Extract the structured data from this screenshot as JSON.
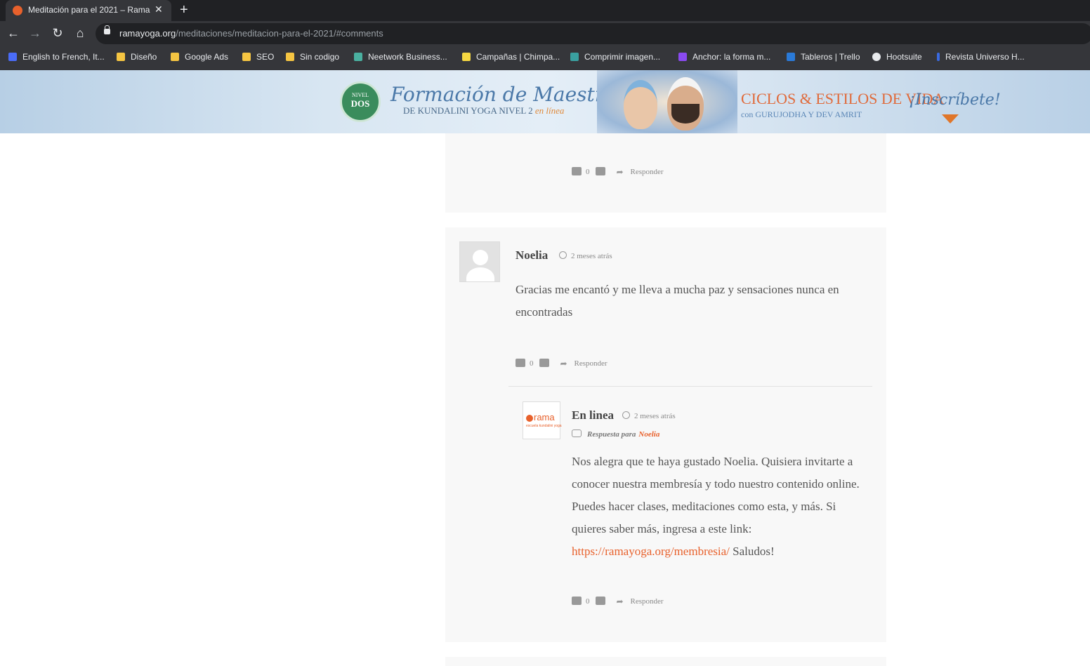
{
  "browser": {
    "tab_title": "Meditación para el 2021 – Rama",
    "url_host": "ramayoga.org",
    "url_path": "/meditaciones/meditacion-para-el-2021/#comments",
    "bookmarks": [
      {
        "label": "English to French, It...",
        "color": "#4a6cf7"
      },
      {
        "label": "Diseño",
        "color": "#f5c542"
      },
      {
        "label": "Google Ads",
        "color": "#f5c542"
      },
      {
        "label": "SEO",
        "color": "#f5c542"
      },
      {
        "label": "Sin codigo",
        "color": "#f5c542"
      },
      {
        "label": "Neetwork Business...",
        "color": "#4ab0a0"
      },
      {
        "label": "Campañas | Chimpa...",
        "color": "#f5d742"
      },
      {
        "label": "Comprimir imagen...",
        "color": "#3aa0a0"
      },
      {
        "label": "Anchor: la forma m...",
        "color": "#8a4af0"
      },
      {
        "label": "Tableros | Trello",
        "color": "#2a7ad8"
      },
      {
        "label": "Hootsuite",
        "color": "#e8eaed"
      },
      {
        "label": "Revista Universo H...",
        "color": "#3a6ae0"
      }
    ]
  },
  "banner": {
    "seal_top": "NIVEL",
    "seal_bottom": "DOS",
    "title": "Formación de Maestros",
    "subtitle": "DE KUNDALINI YOGA NIVEL 2",
    "subtitle_accent": "en línea",
    "cycles": "CICLOS & ESTILOS DE VIDA",
    "with": "con GURUJODHA Y DEV AMRIT",
    "cta": "¡Inscríbete!"
  },
  "comments": {
    "top_actions": {
      "likes": "0",
      "reply": "Responder"
    },
    "noelia": {
      "author": "Noelia",
      "time": "2 meses atrás",
      "text": "Gracias me encantó y me lleva a mucha paz y sensaciones nunca en encontradas",
      "likes": "0",
      "reply": "Responder"
    },
    "reply": {
      "author": "En linea",
      "time": "2 meses atrás",
      "reply_to_label": "Respuesta para",
      "reply_to_name": "Noelia",
      "avatar_text": "rama",
      "avatar_sub": "escuela kundalini yoga",
      "text_before": "Nos alegra que te haya gustado Noelia. Quisiera invitarte a conocer nuestra membresía y todo nuestro contenido online. Puedes hacer clases, meditaciones como esta, y más. Si quieres saber más, ingresa a este link:",
      "link": "https://ramayoga.org/membresia/",
      "text_after": "Saludos!",
      "likes": "0",
      "reply": "Responder"
    }
  }
}
